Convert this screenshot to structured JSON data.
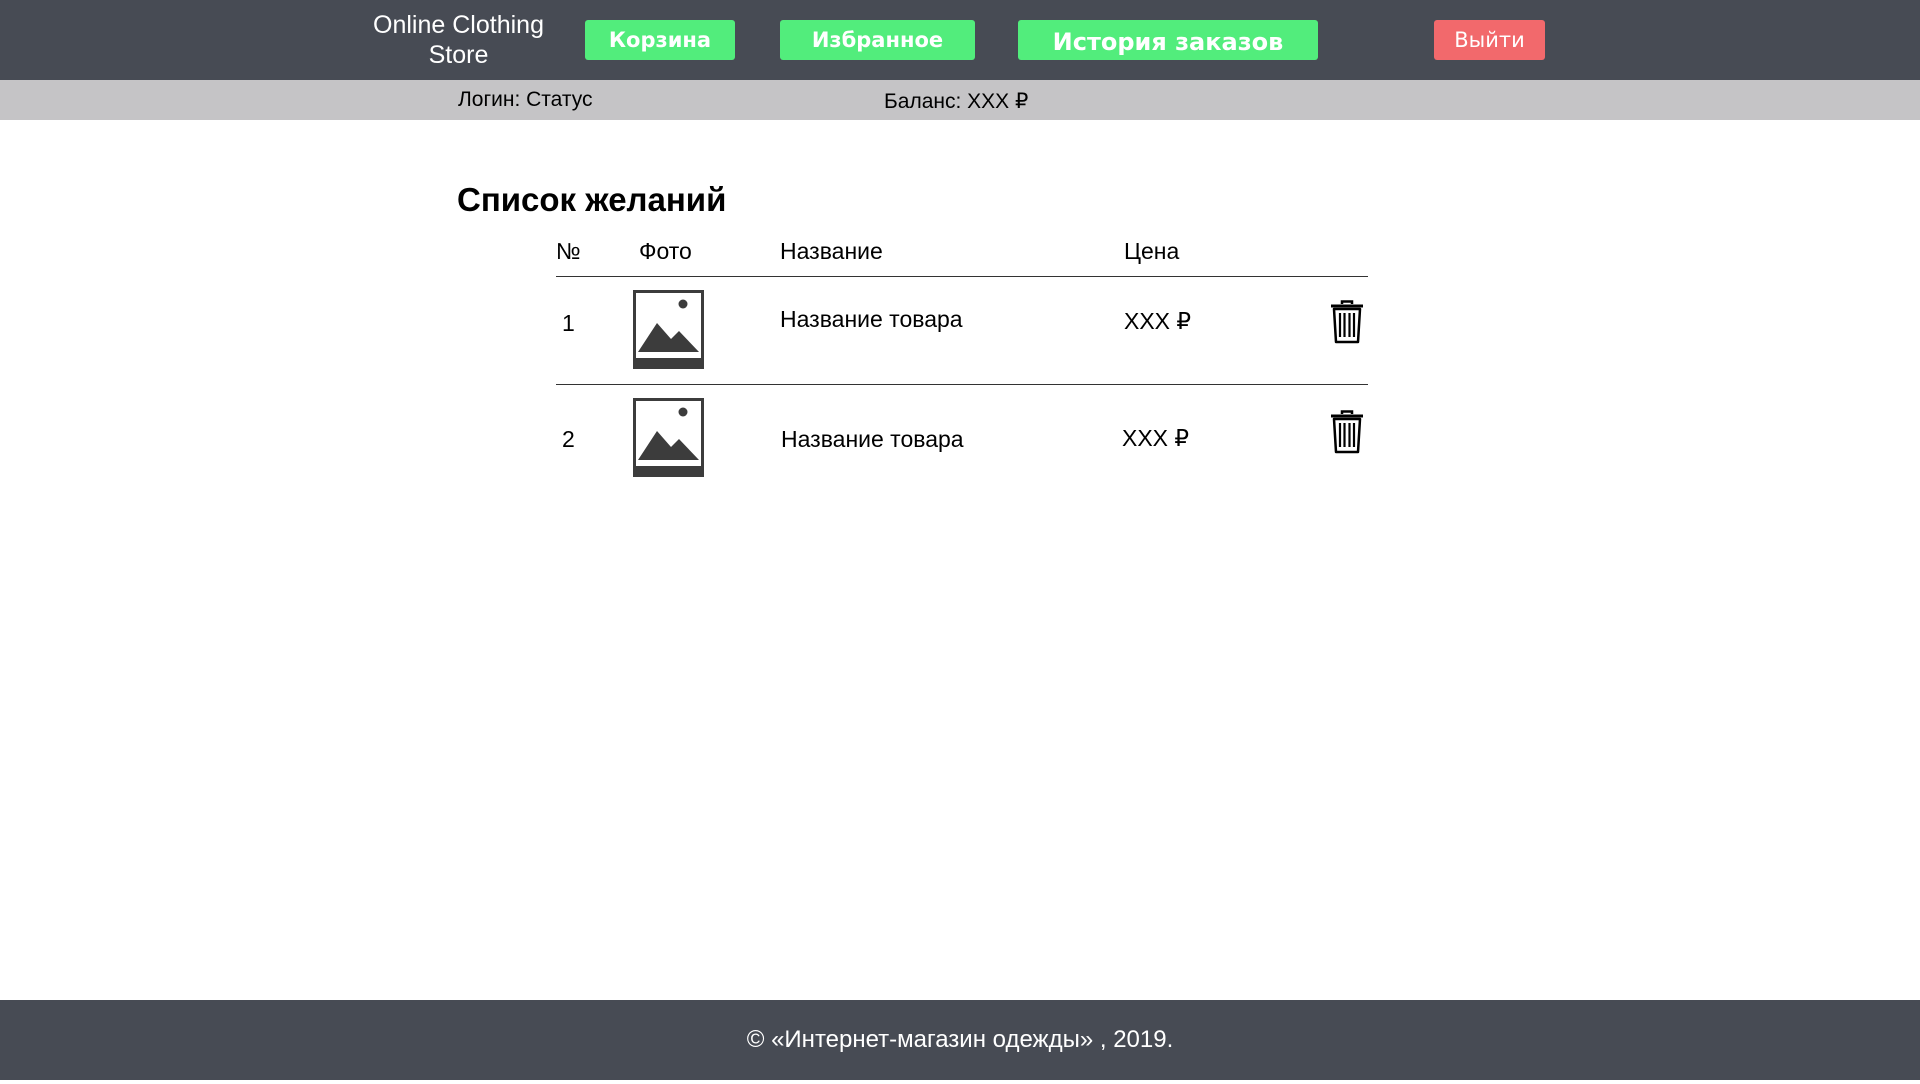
{
  "header": {
    "brand": "Online Clothing\nStore",
    "nav": {
      "cart": "Корзина",
      "favorites": "Избранное",
      "order_history": "История заказов"
    },
    "logout": "Выйти"
  },
  "status": {
    "login": "Логин: Статус",
    "balance": "Баланс: XXX ₽"
  },
  "main": {
    "title": "Список желаний",
    "columns": {
      "num": "№",
      "photo": "Фото",
      "name": "Название",
      "price": "Цена"
    },
    "rows": [
      {
        "num": "1",
        "name": "Название товара",
        "price": "XXX ₽"
      },
      {
        "num": "2",
        "name": "Название товара",
        "price": "XXX ₽"
      }
    ]
  },
  "footer": {
    "text": "© «Интернет-магазин одежды» , 2019."
  },
  "colors": {
    "bar": "#474b54",
    "status_strip": "#c5c4c6",
    "green_button": "#52ed7c",
    "red_button": "#f2696c"
  },
  "icons": [
    "image-placeholder-icon",
    "trash-icon"
  ]
}
